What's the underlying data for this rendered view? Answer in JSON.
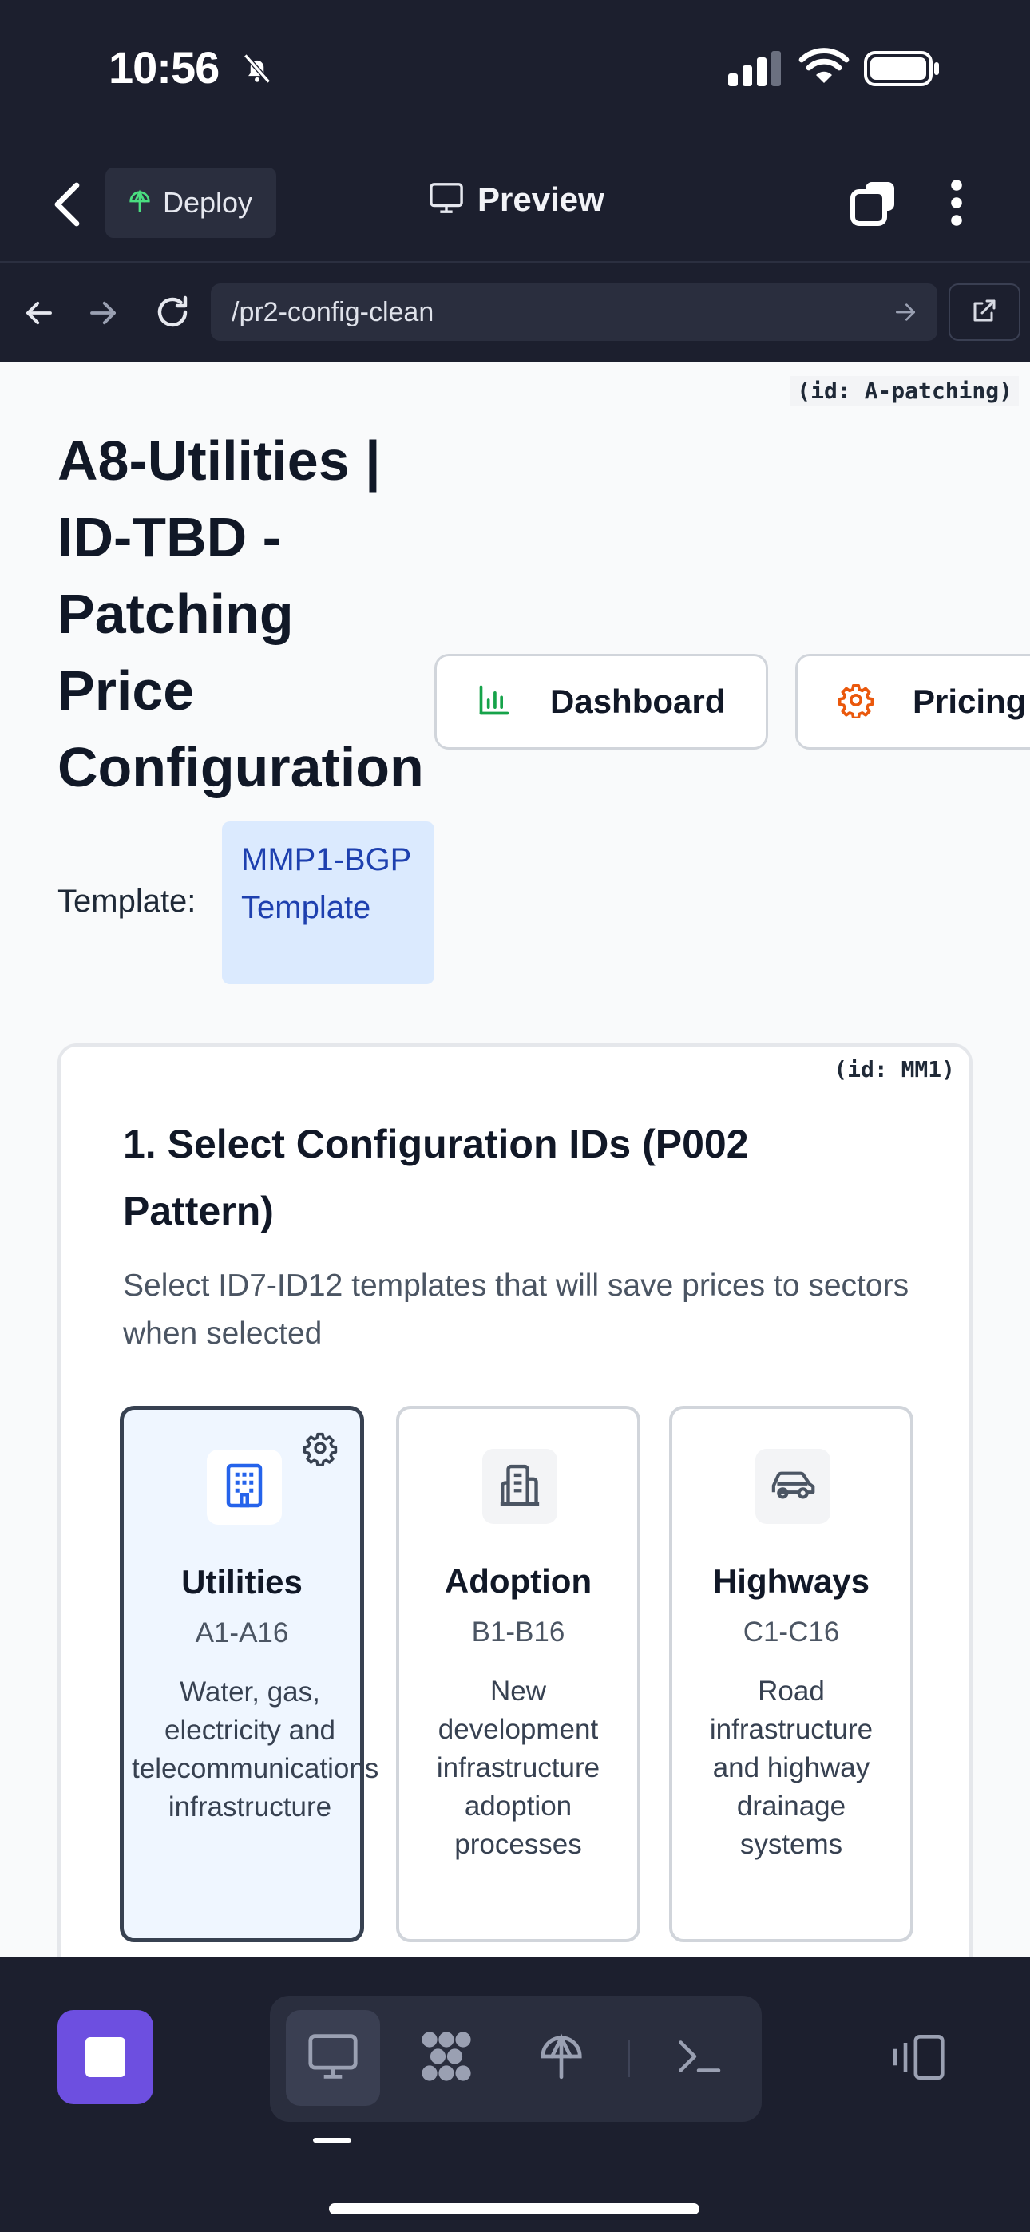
{
  "status_bar": {
    "time": "10:56",
    "icons": [
      "bell-slash-icon",
      "signal-icon",
      "wifi-icon",
      "battery-icon"
    ]
  },
  "app_header": {
    "deploy_label": "Deploy",
    "title": "Preview",
    "icons": [
      "back-icon",
      "deploy-icon",
      "monitor-icon",
      "tabs-icon",
      "more-vertical-icon"
    ]
  },
  "browser": {
    "url": "/pr2-config-clean",
    "icons": [
      "arrow-left-icon",
      "arrow-right-icon",
      "reload-icon",
      "go-arrow-icon",
      "external-link-icon"
    ]
  },
  "page": {
    "id_tag": "(id: A-patching)",
    "title": "A8-Utilities | ID-TBD - Patching Price Configuration",
    "nav_pills": [
      {
        "label": "Dashboard",
        "icon": "bar-chart-icon"
      },
      {
        "label": "Pricing",
        "icon": "gear-icon"
      }
    ],
    "template_label": "Template:",
    "template_value": "MMP1-BGP Template"
  },
  "section": {
    "id_tag": "(id: MM1)",
    "title": "1. Select Configuration IDs (P002 Pattern)",
    "description": "Select ID7-ID12 templates that will save prices to sectors when selected",
    "options": [
      {
        "name": "Utilities",
        "range": "A1-A16",
        "description": "Water, gas, electricity and telecommunications infrastructure",
        "icon": "building-icon",
        "selected": true
      },
      {
        "name": "Adoption",
        "range": "B1-B16",
        "description": "New development infrastructure adoption processes",
        "icon": "document-building-icon",
        "selected": false
      },
      {
        "name": "Highways",
        "range": "C1-C16",
        "description": "Road infrastructure and highway drainage systems",
        "icon": "car-icon",
        "selected": false
      }
    ]
  },
  "toolbar": {
    "icons": [
      "stop-icon",
      "desktop-icon",
      "grid-icon",
      "deploy-icon",
      "terminal-icon",
      "side-panel-icon"
    ],
    "accent": "#6d4fe0"
  },
  "colors": {
    "background_dark": "#1c1f2e",
    "selected_card": "#eff6ff",
    "template_badge": "#dbeafe",
    "template_text": "#1e40af",
    "dashboard_icon": "#16a34a",
    "pricing_icon": "#ea580c",
    "utilities_icon": "#2563eb"
  }
}
